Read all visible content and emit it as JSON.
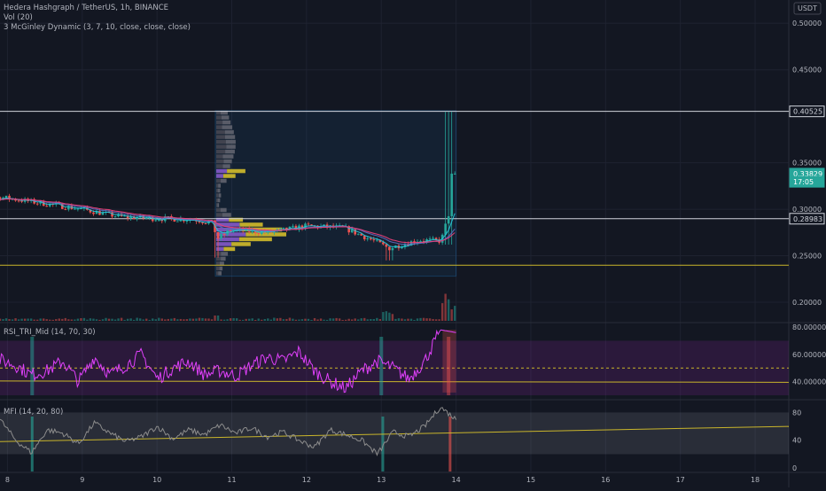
{
  "header": {
    "symbol_line": "Hedera Hashgraph / TetherUS, 1h, BINANCE",
    "indicator_vol": "Vol (20)",
    "indicator_mcginley": "3 McGinley Dynamic (3, 7, 10, close, close, close)"
  },
  "currency_label": "USDT",
  "colors": {
    "background": "#131722",
    "grid": "#1e2230",
    "candle_up": "#26a69a",
    "candle_down": "#ef5350",
    "mcginley_fast": "#26c6da",
    "mcginley_mid": "#5c6bc0",
    "mcginley_slow": "#ec407a",
    "support_line": "#c9b52b",
    "white_line": "#d1d4dc",
    "rsi_line": "#e040fb",
    "mfi_line": "#8c8c8c",
    "vp_up": "#c9b52b",
    "vp_down": "#7e57c2",
    "vp_value_area": "#5d606b",
    "trend_line": "#c9b52b"
  },
  "chart_data": [
    {
      "type": "candlestick",
      "pane": "price",
      "ylim": [
        0.18,
        0.525
      ],
      "y_ticks": [
        "0.50000",
        "0.45000",
        "0.35000",
        "0.30000",
        "0.25000",
        "0.20000"
      ],
      "x_ticks": [
        "8",
        "9",
        "10",
        "11",
        "12",
        "13",
        "14",
        "15",
        "16",
        "17",
        "18"
      ],
      "x_tick_values": [
        8,
        9,
        10,
        11,
        12,
        13,
        14,
        15,
        16,
        17,
        18
      ],
      "xlim": [
        7.9,
        18.45
      ],
      "ohlc_approx": [
        {
          "x": 7.9,
          "close": 0.313
        },
        {
          "x": 8.5,
          "close": 0.306
        },
        {
          "x": 9.0,
          "close": 0.3
        },
        {
          "x": 9.5,
          "close": 0.292
        },
        {
          "x": 10.0,
          "close": 0.29
        },
        {
          "x": 10.5,
          "close": 0.289
        },
        {
          "x": 10.75,
          "close": 0.285
        },
        {
          "x": 10.8,
          "close": 0.268
        },
        {
          "x": 11.0,
          "close": 0.278
        },
        {
          "x": 11.5,
          "close": 0.275
        },
        {
          "x": 12.0,
          "close": 0.282
        },
        {
          "x": 12.5,
          "close": 0.28
        },
        {
          "x": 12.9,
          "close": 0.266
        },
        {
          "x": 13.1,
          "close": 0.258
        },
        {
          "x": 13.5,
          "close": 0.267
        },
        {
          "x": 13.8,
          "close": 0.266
        },
        {
          "x": 13.92,
          "close": 0.3
        },
        {
          "x": 14.0,
          "close": 0.33829
        }
      ],
      "price_tags": [
        {
          "label": "0.40525",
          "value": 0.40525,
          "style": "white"
        },
        {
          "label": "0.33829",
          "value": 0.33829,
          "style": "up"
        },
        {
          "label": "17:05",
          "value": 0.3295,
          "style": "up-sub"
        },
        {
          "label": "0.28983",
          "value": 0.28983,
          "style": "white"
        }
      ],
      "horizontal_lines": [
        {
          "value": 0.40525,
          "color": "white"
        },
        {
          "value": 0.28983,
          "color": "white"
        },
        {
          "value": 0.2398,
          "color": "yellow"
        }
      ],
      "volume_profile_range": {
        "x_start": 10.78,
        "x_end": 14.0,
        "low": 0.228,
        "high": 0.406
      }
    },
    {
      "type": "line",
      "pane": "rsi",
      "title": "RSI_TRI_Mid (14, 70, 30)",
      "ylim": [
        30,
        82
      ],
      "y_ticks": [
        "80.00000",
        "60.00000",
        "40.00000"
      ],
      "y_tick_values": [
        80,
        60,
        40
      ],
      "band": [
        30,
        70
      ],
      "mid_line": 50,
      "trend_line": [
        {
          "x": 7.9,
          "y": 40.5
        },
        {
          "x": 18.45,
          "y": 39.5
        }
      ],
      "series": [
        {
          "name": "RSI",
          "values_approx": [
            56,
            52,
            45,
            48,
            55,
            40,
            58,
            45,
            52,
            60,
            42,
            50,
            55,
            45,
            48,
            44,
            52,
            58,
            55,
            62,
            48,
            40,
            35,
            48,
            55,
            50,
            42,
            55,
            78,
            76
          ]
        }
      ]
    },
    {
      "type": "line",
      "pane": "mfi",
      "title": "MFI (14, 20, 80)",
      "ylim": [
        -5,
        92
      ],
      "y_ticks": [
        "80",
        "40",
        "0"
      ],
      "y_tick_values": [
        80,
        40,
        0
      ],
      "band": [
        20,
        80
      ],
      "trend_line": [
        {
          "x": 7.9,
          "y": 38
        },
        {
          "x": 18.45,
          "y": 60
        }
      ],
      "series": [
        {
          "name": "MFI",
          "values_approx": [
            70,
            40,
            22,
            55,
            50,
            35,
            65,
            50,
            38,
            45,
            60,
            42,
            55,
            48,
            62,
            50,
            58,
            45,
            52,
            40,
            30,
            55,
            48,
            40,
            20,
            52,
            45,
            60,
            88,
            70
          ]
        }
      ]
    }
  ]
}
